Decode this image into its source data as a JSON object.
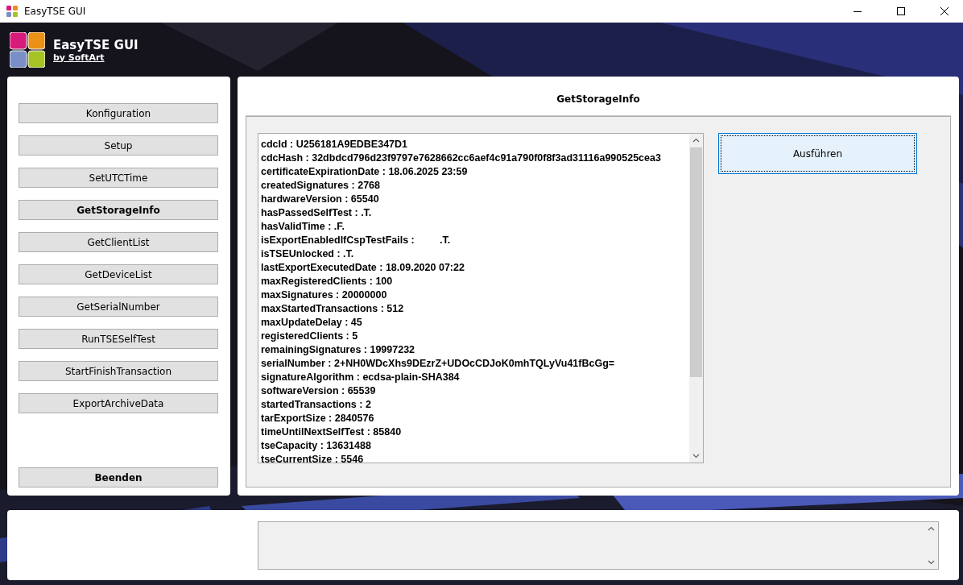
{
  "window": {
    "title": "EasyTSE GUI"
  },
  "header": {
    "title": "EasyTSE GUI",
    "subtitle": "by SoftArt"
  },
  "menu": [
    {
      "label": "Konfiguration",
      "selected": false
    },
    {
      "label": "Setup",
      "selected": false
    },
    {
      "label": "SetUTCTime",
      "selected": false
    },
    {
      "label": "GetStorageInfo",
      "selected": true
    },
    {
      "label": "GetClientList",
      "selected": false
    },
    {
      "label": "GetDeviceList",
      "selected": false
    },
    {
      "label": "GetSerialNumber",
      "selected": false
    },
    {
      "label": "RunTSESelfTest",
      "selected": false
    },
    {
      "label": "StartFinishTransaction",
      "selected": false
    },
    {
      "label": "ExportArchiveData",
      "selected": false
    }
  ],
  "exit_button": "Beenden",
  "panel": {
    "title": "GetStorageInfo",
    "run_button": "Ausführen",
    "output": [
      "cdcId : U256181A9EDBE347D1",
      "cdcHash : 32dbdcd796d23f9797e7628662cc6aef4c91a790f0f8f3ad31116a990525cea3",
      "certificateExpirationDate : 18.06.2025 23:59",
      "createdSignatures : 2768",
      "hardwareVersion : 65540",
      "hasPassedSelfTest : .T.",
      "hasValidTime : .F.",
      "isExportEnabledIfCspTestFails :         .T.",
      "isTSEUnlocked : .T.",
      "lastExportExecutedDate : 18.09.2020 07:22",
      "maxRegisteredClients : 100",
      "maxSignatures : 20000000",
      "maxStartedTransactions : 512",
      "maxUpdateDelay : 45",
      "registeredClients : 5",
      "remainingSignatures : 19997232",
      "serialNumber : 2+NH0WDcXhs9DEzrZ+UDOcCDJoK0mhTQLyVu41fBcGg=",
      "signatureAlgorithm : ecdsa-plain-SHA384",
      "softwareVersion : 65539",
      "startedTransactions : 2",
      "tarExportSize : 2840576",
      "timeUntilNextSelfTest : 85840",
      "tseCapacity : 13631488",
      "tseCurrentSize : 5546"
    ]
  }
}
